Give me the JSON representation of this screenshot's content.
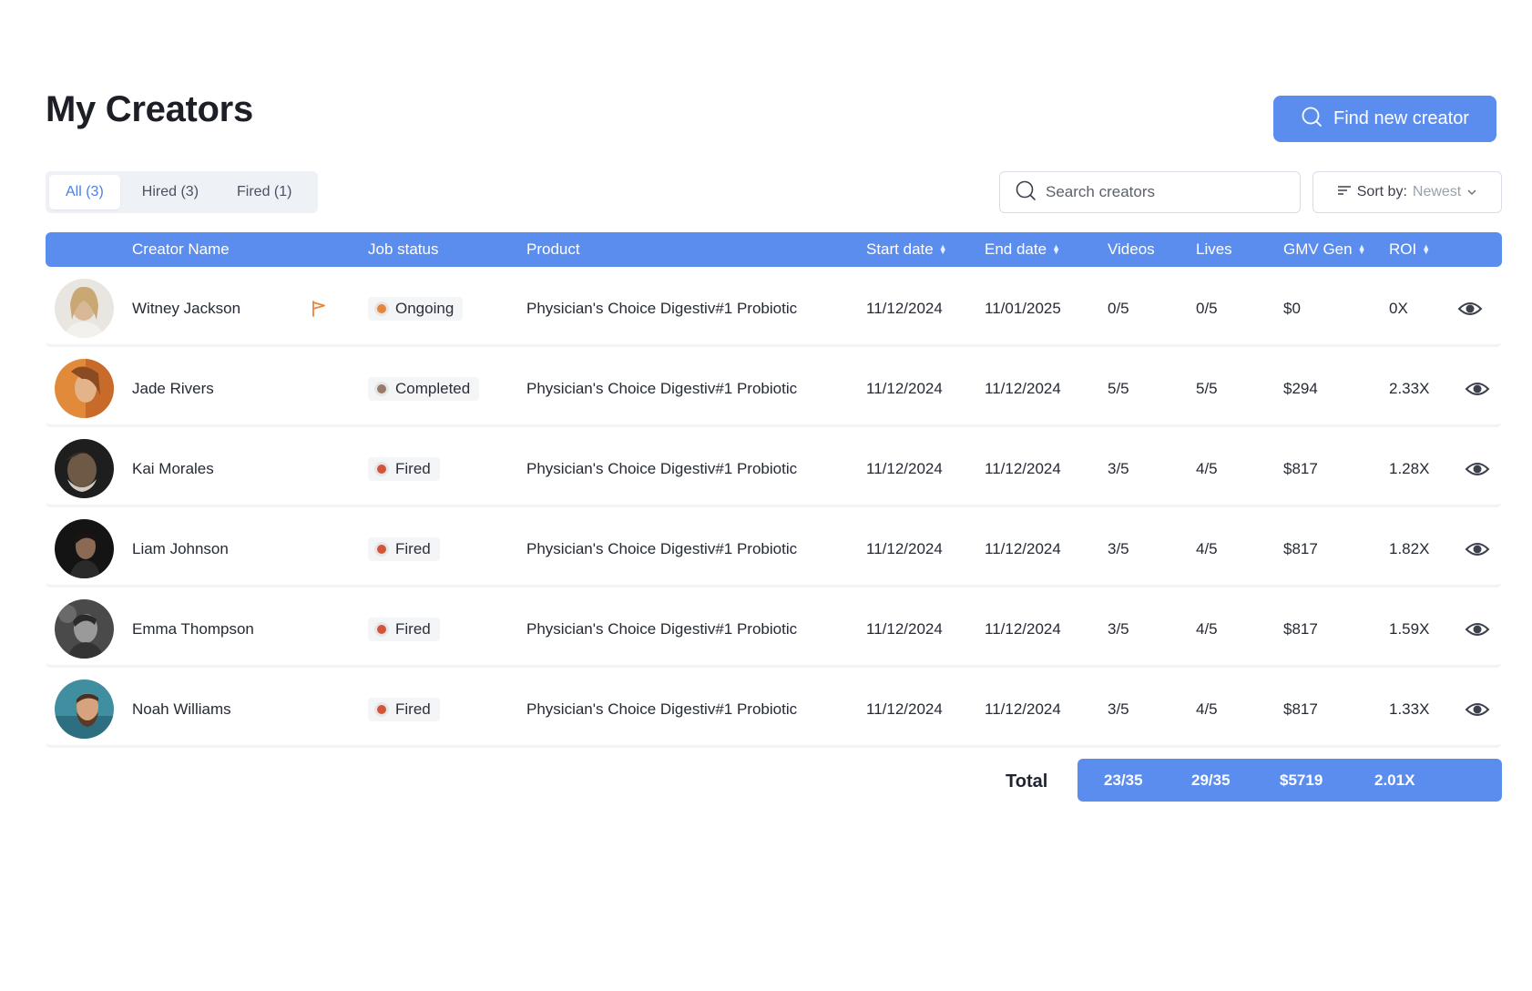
{
  "page": {
    "title": "My Creators",
    "find_button": "Find new creator"
  },
  "tabs": [
    {
      "label": "All (3)",
      "active": true
    },
    {
      "label": "Hired (3)",
      "active": false
    },
    {
      "label": "Fired (1)",
      "active": false
    }
  ],
  "search": {
    "placeholder": "Search creators",
    "value": ""
  },
  "sort": {
    "label": "Sort by:",
    "value": "Newest"
  },
  "table": {
    "headers": {
      "creator_name": "Creator Name",
      "job_status": "Job status",
      "product": "Product",
      "start_date": "Start date",
      "end_date": "End date",
      "videos": "Videos",
      "lives": "Lives",
      "gmv_gen": "GMV Gen",
      "roi": "ROI"
    },
    "rows": [
      {
        "name": "Witney Jackson",
        "flagged": true,
        "status": "Ongoing",
        "status_color": "#e8843c",
        "product": "Physician's Choice Digestiv#1 Probiotic",
        "start": "11/12/2024",
        "end": "11/01/2025",
        "videos": "0/5",
        "lives": "0/5",
        "gmv": "$0",
        "roi": "0X"
      },
      {
        "name": "Jade Rivers",
        "flagged": false,
        "status": "Completed",
        "status_color": "#9a7b6a",
        "product": "Physician's Choice Digestiv#1 Probiotic",
        "start": "11/12/2024",
        "end": "11/12/2024",
        "videos": "5/5",
        "lives": "5/5",
        "gmv": "$294",
        "roi": "2.33X"
      },
      {
        "name": "Kai Morales",
        "flagged": false,
        "status": "Fired",
        "status_color": "#d4553a",
        "product": "Physician's Choice Digestiv#1 Probiotic",
        "start": "11/12/2024",
        "end": "11/12/2024",
        "videos": "3/5",
        "lives": "4/5",
        "gmv": "$817",
        "roi": "1.28X"
      },
      {
        "name": "Liam Johnson",
        "flagged": false,
        "status": "Fired",
        "status_color": "#d4553a",
        "product": "Physician's Choice Digestiv#1 Probiotic",
        "start": "11/12/2024",
        "end": "11/12/2024",
        "videos": "3/5",
        "lives": "4/5",
        "gmv": "$817",
        "roi": "1.82X"
      },
      {
        "name": "Emma Thompson",
        "flagged": false,
        "status": "Fired",
        "status_color": "#d4553a",
        "product": "Physician's Choice Digestiv#1 Probiotic",
        "start": "11/12/2024",
        "end": "11/12/2024",
        "videos": "3/5",
        "lives": "4/5",
        "gmv": "$817",
        "roi": "1.59X"
      },
      {
        "name": "Noah Williams",
        "flagged": false,
        "status": "Fired",
        "status_color": "#d4553a",
        "product": "Physician's Choice Digestiv#1 Probiotic",
        "start": "11/12/2024",
        "end": "11/12/2024",
        "videos": "3/5",
        "lives": "4/5",
        "gmv": "$817",
        "roi": "1.33X"
      }
    ]
  },
  "totals": {
    "label": "Total",
    "videos": "23/35",
    "lives": "29/35",
    "gmv": "$5719",
    "roi": "2.01X"
  },
  "colors": {
    "accent": "#5b8def",
    "flag": "#e8843c"
  },
  "icons": {
    "find_button": "search-icon",
    "search": "search-icon",
    "sort": "sort-lines-icon",
    "sort_chevron": "chevron-down-icon",
    "flag": "flag-icon",
    "view": "eye-icon"
  }
}
